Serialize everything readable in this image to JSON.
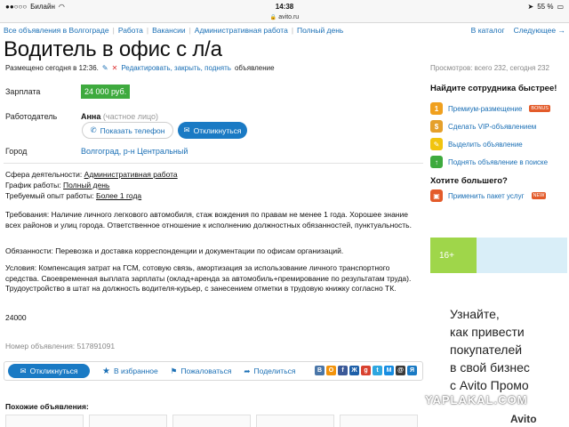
{
  "statusbar": {
    "carrier": "Билайн",
    "time": "14:38",
    "battery": "55 %"
  },
  "urlbar": {
    "host": "avito.ru"
  },
  "breadcrumbs": {
    "items": [
      "Все объявления в Волгограде",
      "Работа",
      "Вакансии",
      "Административная работа",
      "Полный день"
    ],
    "to_catalog": "В каталог",
    "next": "Следующее →"
  },
  "ad": {
    "title": "Водитель в офис с л/а",
    "placed": "Размещено сегодня в 12:36.",
    "edit_link": "Редактировать, закрыть, поднять",
    "edit_suffix": "объявление",
    "views": "Просмотров: всего 232, сегодня 232",
    "salary_label": "Зарплата",
    "salary_value": "24 000 руб.",
    "employer_label": "Работодатель",
    "employer_name": "Анна",
    "employer_type": "(частное лицо)",
    "show_phone": "Показать телефон",
    "respond": "Откликнуться",
    "city_label": "Город",
    "city_value": "Волгоград, р-н Центральный",
    "sphere_label": "Сфера деятельности:",
    "sphere_value": "Административная работа",
    "schedule_label": "График работы:",
    "schedule_value": "Полный день",
    "experience_label": "Требуемый опыт работы:",
    "experience_value": "Более 1 года",
    "requirements": "Требования: Наличие личного легкового автомобиля, стаж вождения по правам не менее 1 года. Хорошее знание всех районов и улиц города. Ответственное отношение к исполнению должностных обязанностей, пунктуальность.",
    "duties": "Обязанности: Перевозка и доставка корреспонденции и документации по офисам организаций.",
    "conditions": "Условия: Компенсация затрат на ГСМ, сотовую связь, амортизация за использование личного транспортного средства. Своевременная выплата зарплаты (оклад+аренда за автомобиль+премирование по результатам труда). Трудоустройство в штат на должность водителя-курьер, с занесением отметки в трудовую книжку согласно ТК.",
    "price_plain": "24000",
    "ad_number": "Номер объявления: 517891091"
  },
  "actions": {
    "respond": "Откликнуться",
    "favorite": "В избранное",
    "complain": "Пожаловаться",
    "share": "Поделиться"
  },
  "social_buttons": [
    {
      "letter": "В",
      "color": "#4a76a8"
    },
    {
      "letter": "О",
      "color": "#f2930c"
    },
    {
      "letter": "f",
      "color": "#3b5998"
    },
    {
      "letter": "Ж",
      "color": "#1d5fa8"
    },
    {
      "letter": "g",
      "color": "#d8412f"
    },
    {
      "letter": "t",
      "color": "#2ea7e0"
    },
    {
      "letter": "М",
      "color": "#168de2"
    },
    {
      "letter": "@",
      "color": "#3a3a3a"
    },
    {
      "letter": "Я",
      "color": "#1a7ac4"
    }
  ],
  "similar": {
    "title": "Похожие объявления:"
  },
  "sidebar": {
    "find_title": "Найдите сотрудника быстрее!",
    "items": [
      {
        "label": "Премиум-размещение",
        "badge": "BONUS",
        "icon": "1",
        "color": "#f0a01e"
      },
      {
        "label": "Сделать VIP-объявлением",
        "badge": "",
        "icon": "$",
        "color": "#e5a02b"
      },
      {
        "label": "Выделить объявление",
        "badge": "",
        "icon": "✎",
        "color": "#f1c40f"
      },
      {
        "label": "Поднять объявление в поиске",
        "badge": "",
        "icon": "↑",
        "color": "#3eaa3e"
      }
    ],
    "more_title": "Хотите большего?",
    "package": {
      "label": "Применить пакет услуг",
      "badge": "NEW",
      "color": "#e35b2a"
    }
  },
  "promo": {
    "age": "16+",
    "headline": "Узнайте,\nкак привести\nпокупателей\nв свой бизнес\nс Avito Промо",
    "brand": "Avito"
  },
  "watermark": "YAPLAKAL.COM"
}
